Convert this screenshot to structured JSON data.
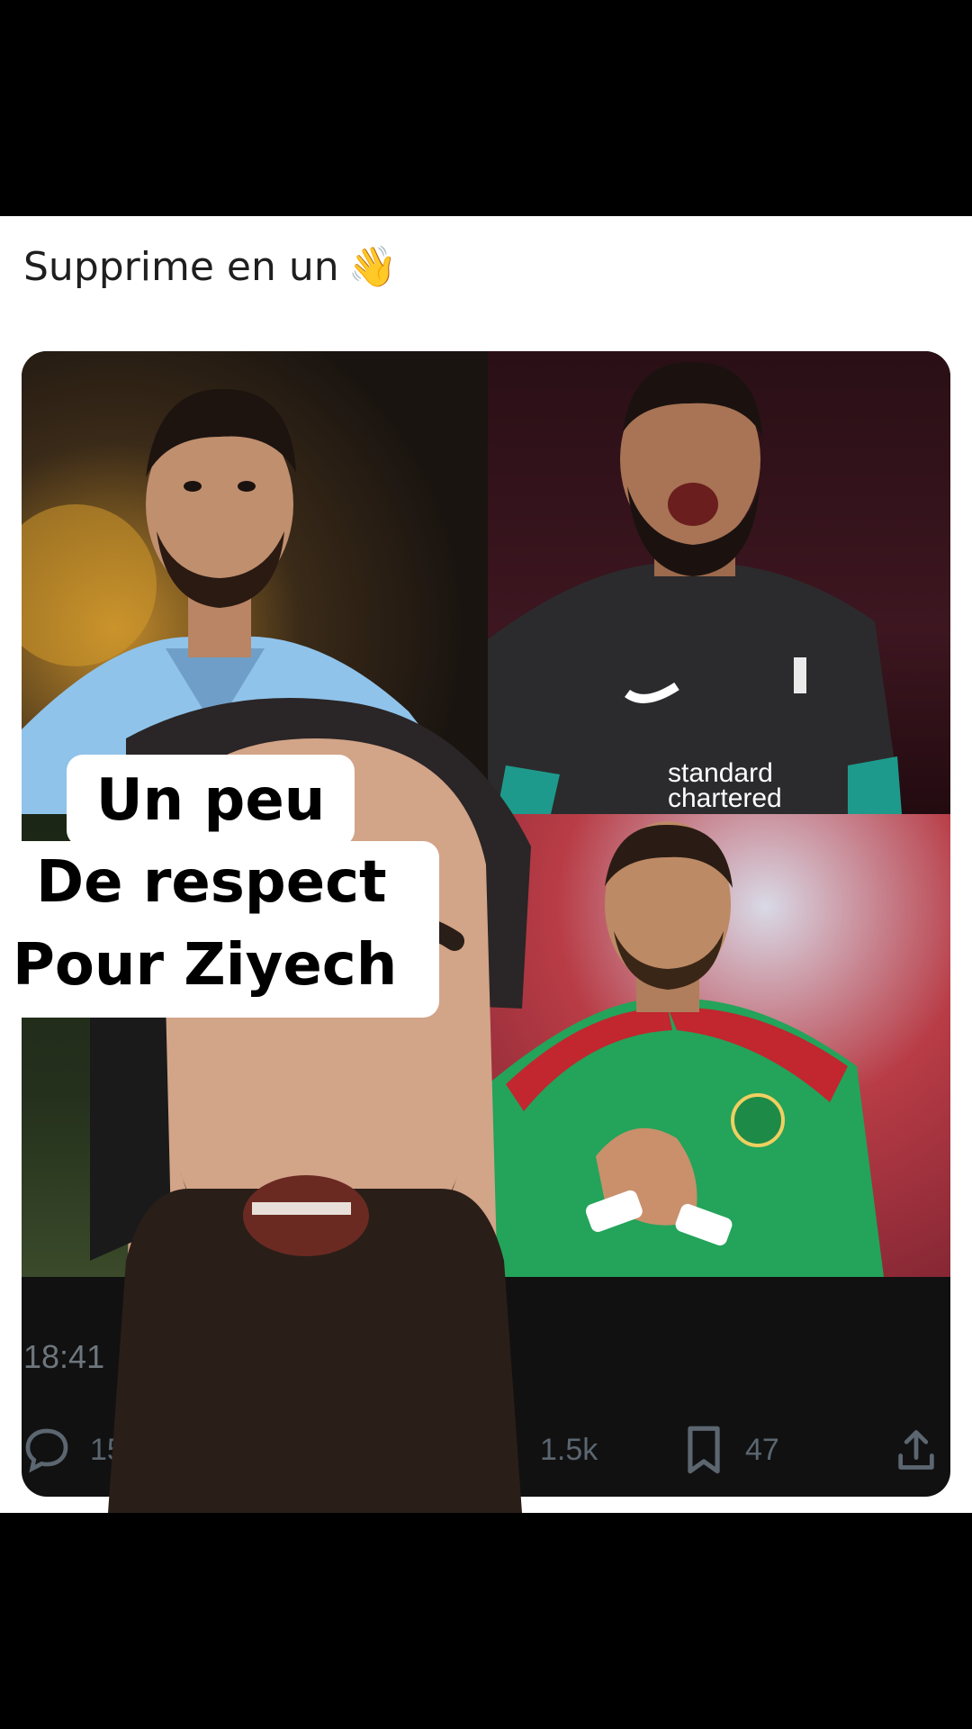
{
  "post": {
    "text": "Supprime en un",
    "emoji": "👋",
    "timestamp": "18:41",
    "actions": {
      "replies": "15",
      "likes": "1.5k",
      "bookmarks": "47"
    }
  },
  "caption": {
    "line1": "Un peu",
    "line2": "De respect",
    "line3": "Pour Ziyech"
  },
  "icons": [
    "wave-emoji-icon",
    "reply-icon",
    "like-icon",
    "bookmark-icon",
    "share-icon"
  ],
  "colors": {
    "background": "#000000",
    "post_background": "#ffffff",
    "secondary_text": "#6e767d",
    "caption_background": "#ffffff",
    "caption_text": "#000000"
  }
}
